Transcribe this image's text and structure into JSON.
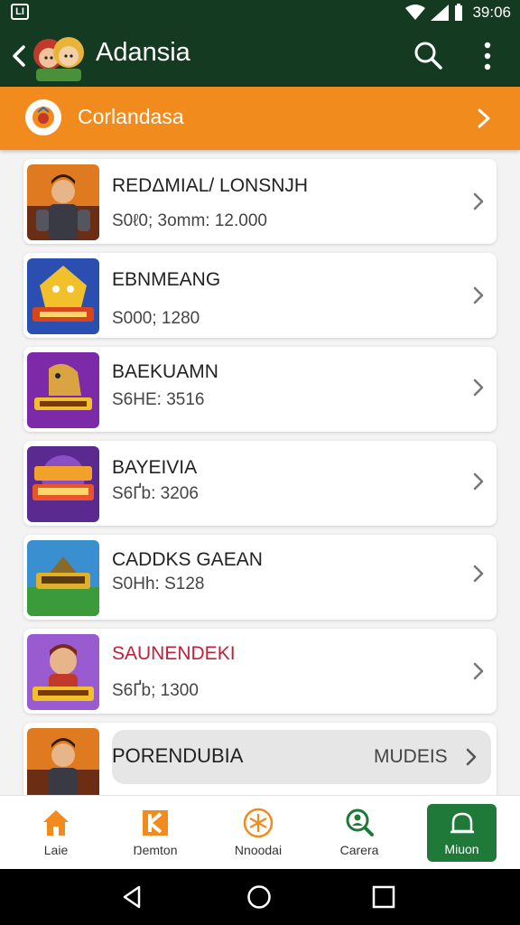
{
  "status_bar": {
    "left_badge": "LI",
    "time": "39:06"
  },
  "app_bar": {
    "title": "Adansia"
  },
  "banner": {
    "title": "Corlandasa"
  },
  "list": {
    "items": [
      {
        "title": "REDΔMIAL/ LONSNJH",
        "subtitle": "S0ℓ0; 3omm: 12.000",
        "title_color": "#222222"
      },
      {
        "title": "EBNMEANG",
        "subtitle": "S000; 1280",
        "title_color": "#222222"
      },
      {
        "title": "BAEKUAMN",
        "subtitle": "S6HE: 3516",
        "title_color": "#222222"
      },
      {
        "title": "BAYEIVIA",
        "subtitle": "S6Ґb: 3206",
        "title_color": "#222222"
      },
      {
        "title": "CADDKS GAEAN",
        "subtitle": "S0Hh: S128",
        "title_color": "#222222"
      },
      {
        "title": "SAUNENDEKI",
        "subtitle": "S6Ґb; 1300",
        "title_color": "#c0213a"
      }
    ],
    "partial_item": {
      "title": "PORENDUBIA",
      "action_label": "MUDEIS"
    }
  },
  "bottom_nav": {
    "items": [
      {
        "label": "Laie",
        "icon": "home-icon"
      },
      {
        "label": "Ŋemton",
        "icon": "bookmark-icon"
      },
      {
        "label": "Nnoodai",
        "icon": "asterisk-circle-icon"
      },
      {
        "label": "Carera",
        "icon": "search-person-icon"
      },
      {
        "label": "Miuon",
        "icon": "bell-icon"
      }
    ]
  },
  "colors": {
    "appbar": "#143a22",
    "banner": "#f28b1d",
    "accent_green": "#1f7a3a",
    "accent_orange": "#f28b1d"
  }
}
